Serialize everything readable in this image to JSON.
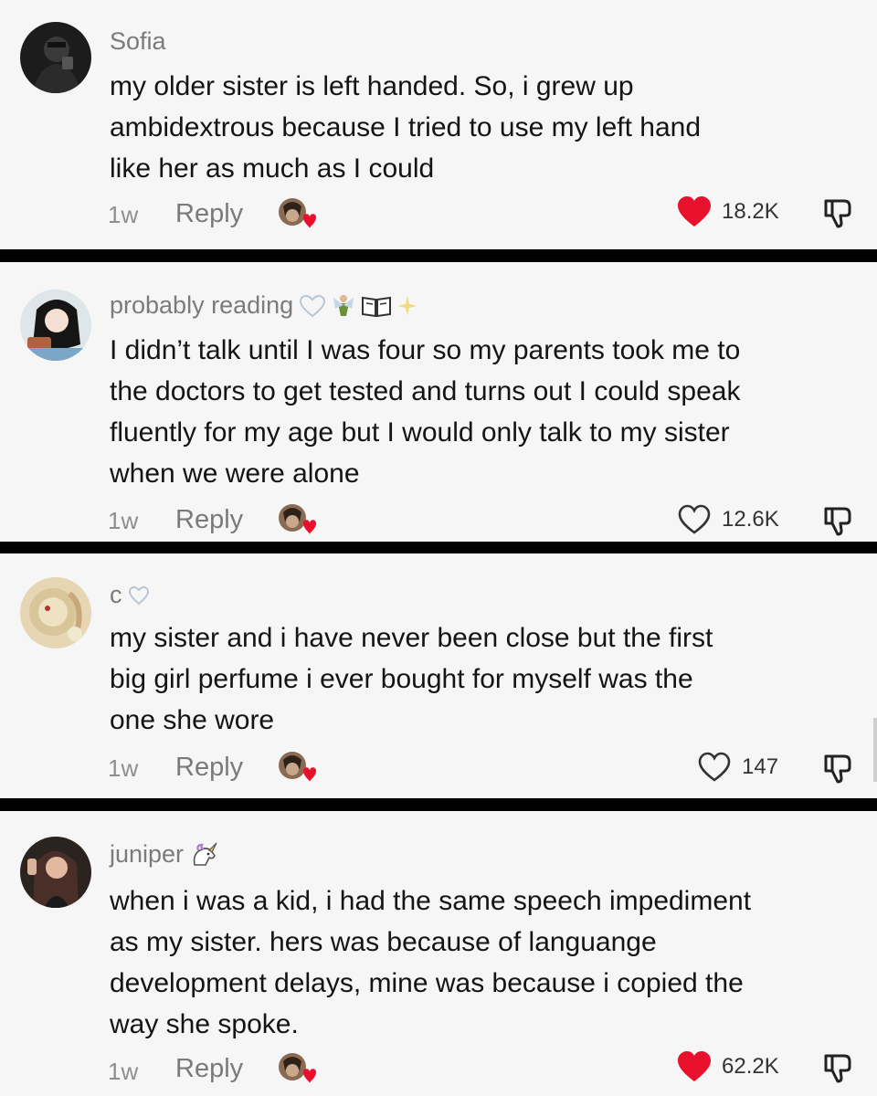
{
  "colors": {
    "background": "#f6f6f6",
    "divider": "#000000",
    "username": "#7b7b7b",
    "text": "#141414",
    "meta": "#8e8e8e",
    "like_active": "#e8112d"
  },
  "comments": [
    {
      "username": "Sofia",
      "text": "my older sister is left handed. So, i grew up\nambidextrous because I tried to use my left hand\nlike her as much as I could",
      "time": "1w",
      "reply_label": "Reply",
      "likes": "18.2K",
      "liked": true,
      "username_deco": []
    },
    {
      "username": "probably reading",
      "text": "I didn’t talk until I was four so my parents took me to\nthe doctors to get tested and turns out I could speak\nfluently for my age but I would only talk to my sister\nwhen we were alone",
      "time": "1w",
      "reply_label": "Reply",
      "likes": "12.6K",
      "liked": false,
      "username_deco": [
        "heart-outline-icon",
        "fairy-icon",
        "book-icon",
        "sparkle-icon"
      ]
    },
    {
      "username": "c",
      "text": "my sister and i have never been close but the first\nbig girl perfume i ever bought for myself was the\none she wore",
      "time": "1w",
      "reply_label": "Reply",
      "likes": "147",
      "liked": false,
      "username_deco": [
        "heart-outline-icon"
      ]
    },
    {
      "username": "juniper",
      "text": "when i was a kid, i had the same speech impediment\nas my sister. hers was because of languange\ndevelopment delays, mine was because i copied the\nway she spoke.",
      "time": "1w",
      "reply_label": "Reply",
      "likes": "62.2K",
      "liked": true,
      "username_deco": [
        "unicorn-icon"
      ]
    }
  ]
}
